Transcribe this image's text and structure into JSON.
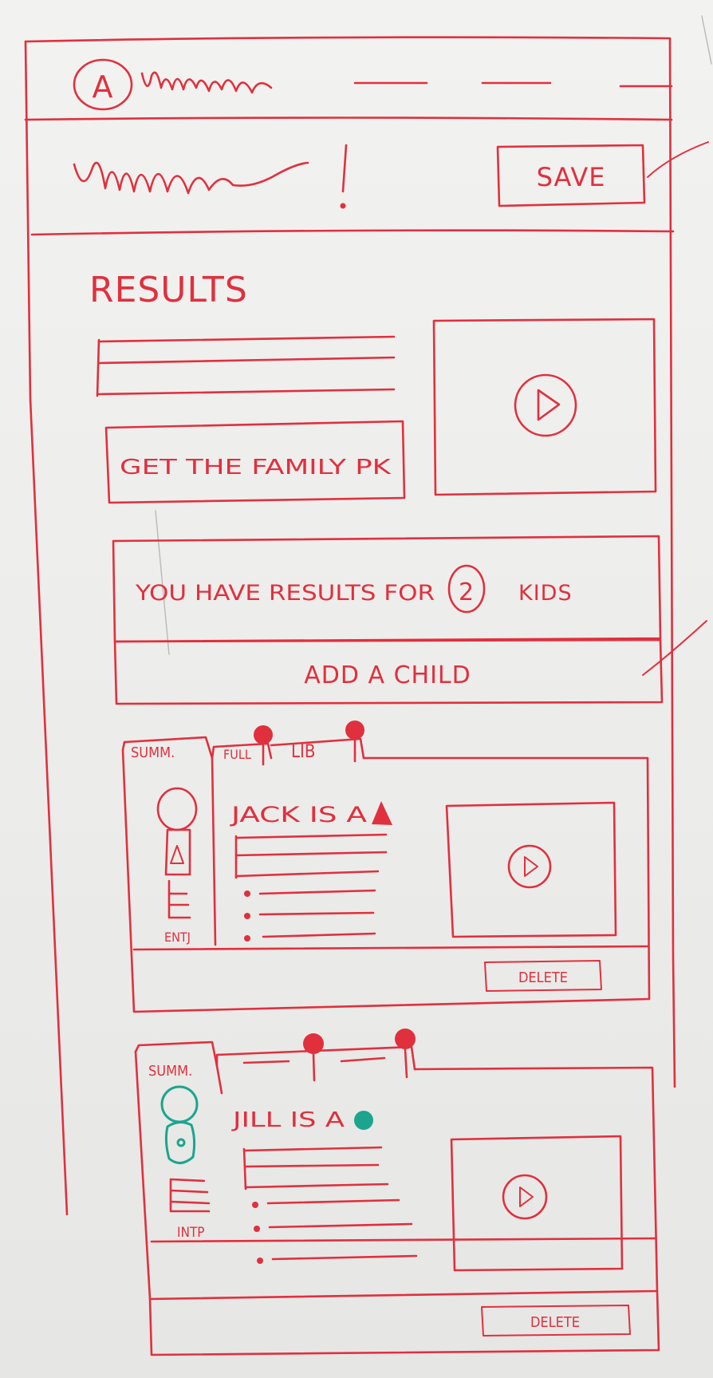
{
  "header": {
    "logo_letter": "A",
    "title_squiggle": "mmm!"
  },
  "toolbar": {
    "save_label": "SAVE"
  },
  "results": {
    "heading": "RESULTS",
    "cta_label": "GET THE FAMILY PK",
    "summary_prefix": "YOU HAVE RESULTS FOR",
    "kid_count": "2",
    "summary_suffix": "KIDS",
    "add_child_label": "ADD A CHILD"
  },
  "children": [
    {
      "tabs": [
        "SUMM.",
        "FULL",
        "LIB"
      ],
      "headline": "JACK IS A",
      "type_code": "ENTJ",
      "delete_label": "DELETE",
      "accent_color": "#e0303e"
    },
    {
      "tabs": [
        "SUMM."
      ],
      "headline": "JILL IS A",
      "type_code": "INTP",
      "delete_label": "DELETE",
      "accent_color": "#1ba58f"
    }
  ],
  "colors": {
    "marker_red": "#e0303e",
    "marker_teal": "#1ba58f",
    "whiteboard": "#eeeeec"
  }
}
